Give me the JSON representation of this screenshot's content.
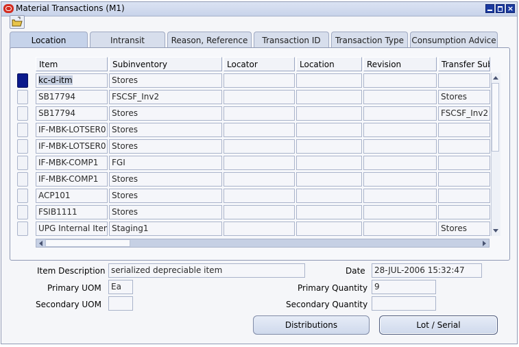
{
  "window": {
    "title": "Material Transactions (M1)"
  },
  "tabs": [
    {
      "label": "Location",
      "active": true
    },
    {
      "label": "Intransit",
      "active": false
    },
    {
      "label": "Reason, Reference",
      "active": false
    },
    {
      "label": "Transaction ID",
      "active": false
    },
    {
      "label": "Transaction Type",
      "active": false
    },
    {
      "label": "Consumption Advice",
      "active": false
    }
  ],
  "table": {
    "columns": [
      "Item",
      "Subinventory",
      "Locator",
      "Location",
      "Revision",
      "Transfer Sub"
    ],
    "rows": [
      {
        "item": "kc-d-itm",
        "subinventory": "Stores",
        "locator": "",
        "location": "",
        "revision": "",
        "transfer_sub": "",
        "selected": true
      },
      {
        "item": "SB17794",
        "subinventory": "FSCSF_Inv2",
        "locator": "",
        "location": "",
        "revision": "",
        "transfer_sub": "Stores",
        "selected": false
      },
      {
        "item": "SB17794",
        "subinventory": "Stores",
        "locator": "",
        "location": "",
        "revision": "",
        "transfer_sub": "FSCSF_Inv2",
        "selected": false
      },
      {
        "item": "IF-MBK-LOTSER0",
        "subinventory": "Stores",
        "locator": "",
        "location": "",
        "revision": "",
        "transfer_sub": "",
        "selected": false
      },
      {
        "item": "IF-MBK-LOTSER0",
        "subinventory": "Stores",
        "locator": "",
        "location": "",
        "revision": "",
        "transfer_sub": "",
        "selected": false
      },
      {
        "item": "IF-MBK-COMP1",
        "subinventory": "FGI",
        "locator": "",
        "location": "",
        "revision": "",
        "transfer_sub": "",
        "selected": false
      },
      {
        "item": "IF-MBK-COMP1",
        "subinventory": "Stores",
        "locator": "",
        "location": "",
        "revision": "",
        "transfer_sub": "",
        "selected": false
      },
      {
        "item": "ACP101",
        "subinventory": "Stores",
        "locator": "",
        "location": "",
        "revision": "",
        "transfer_sub": "",
        "selected": false
      },
      {
        "item": "FSIB1111",
        "subinventory": "Stores",
        "locator": "",
        "location": "",
        "revision": "",
        "transfer_sub": "",
        "selected": false
      },
      {
        "item": "UPG Internal Item",
        "subinventory": "Staging1",
        "locator": "",
        "location": "",
        "revision": "",
        "transfer_sub": "Stores",
        "selected": false
      }
    ]
  },
  "details": {
    "item_description_label": "Item Description",
    "item_description": "serialized depreciable item",
    "date_label": "Date",
    "date": "28-JUL-2006 15:32:47",
    "primary_uom_label": "Primary UOM",
    "primary_uom": "Ea",
    "primary_quantity_label": "Primary Quantity",
    "primary_quantity": "9",
    "secondary_uom_label": "Secondary UOM",
    "secondary_uom": "",
    "secondary_quantity_label": "Secondary Quantity",
    "secondary_quantity": ""
  },
  "buttons": {
    "distributions": "Distributions",
    "lot_serial": "Lot / Serial"
  },
  "colors": {
    "selection_indicator": "#0b1a8c",
    "title_icon": "#d32b1f",
    "window_buttons": "#1b3aa0"
  }
}
